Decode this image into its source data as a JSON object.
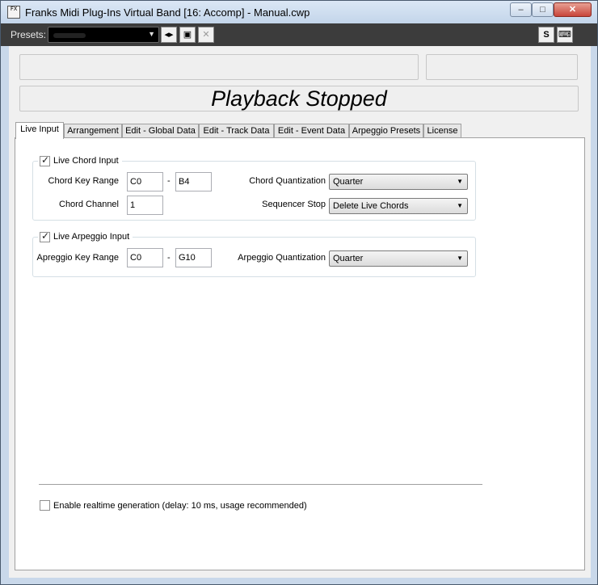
{
  "window": {
    "title": "Franks Midi Plug-Ins Virtual Band [16: Accomp] - Manual.cwp",
    "app_icon_text": "FX",
    "minimize_glyph": "–",
    "maximize_glyph": "□",
    "close_glyph": "✕"
  },
  "toolbar": {
    "presets_label": "Presets:",
    "preset_value": "",
    "prev_next_glyph": "◂▸",
    "save_glyph": "▣",
    "delete_glyph": "✕",
    "s_button_label": "S",
    "keyboard_glyph": "⌨"
  },
  "status": {
    "text": "Playback Stopped"
  },
  "tabs": [
    {
      "label": "Live Input",
      "active": true
    },
    {
      "label": "Arrangement"
    },
    {
      "label": "Edit - Global Data"
    },
    {
      "label": "Edit - Track Data"
    },
    {
      "label": "Edit - Event Data"
    },
    {
      "label": "Arpeggio Presets"
    },
    {
      "label": "License"
    }
  ],
  "live_chord": {
    "title": "Live Chord Input",
    "checked": true,
    "key_range_label": "Chord Key Range",
    "key_from": "C0",
    "key_sep": "-",
    "key_to": "B4",
    "channel_label": "Chord Channel",
    "channel": "1",
    "quant_label": "Chord Quantization",
    "quant_value": "Quarter",
    "seq_stop_label": "Sequencer Stop",
    "seq_stop_value": "Delete Live Chords"
  },
  "live_arp": {
    "title": "Live Arpeggio Input",
    "checked": true,
    "key_range_label": "Apreggio Key Range",
    "key_from": "C0",
    "key_sep": "-",
    "key_to": "G10",
    "quant_label": "Arpeggio Quantization",
    "quant_value": "Quarter"
  },
  "realtime": {
    "label": "Enable realtime generation (delay: 10 ms, usage recommended)",
    "checked": false
  },
  "icons": {
    "checkmark": "✓",
    "dropdown": "▼"
  }
}
